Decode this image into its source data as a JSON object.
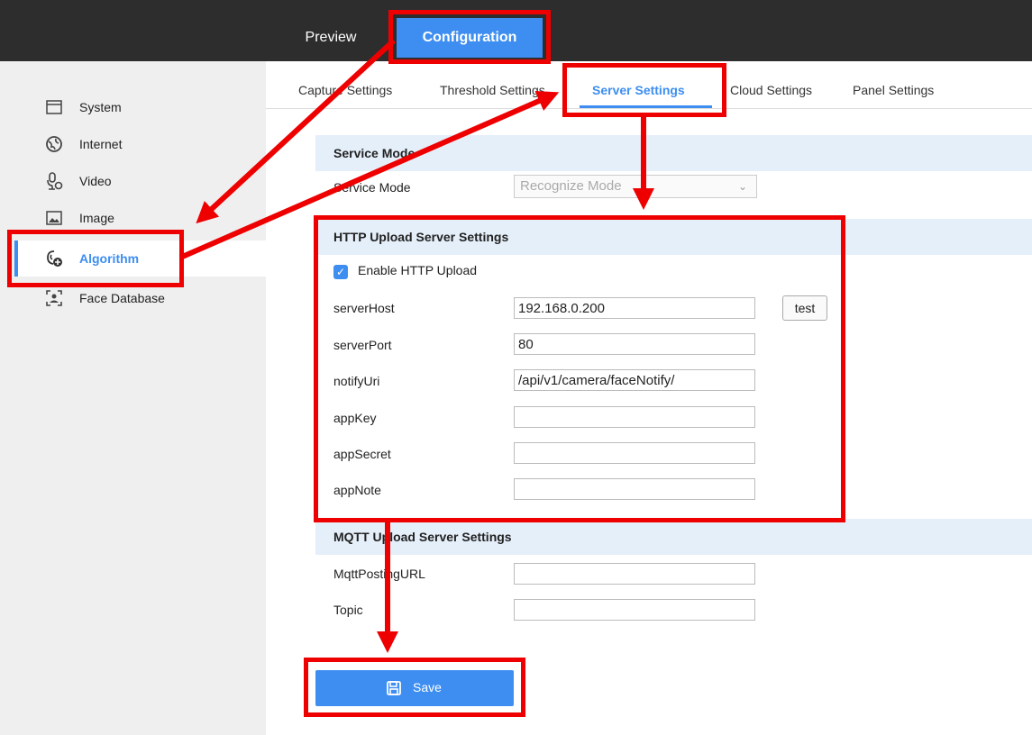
{
  "topbar": {
    "tabs": [
      {
        "label": "Preview"
      },
      {
        "label": "Configuration"
      }
    ]
  },
  "sidebar": {
    "items": [
      {
        "label": "System",
        "icon": "system-icon"
      },
      {
        "label": "Internet",
        "icon": "globe-icon"
      },
      {
        "label": "Video",
        "icon": "microphone-icon"
      },
      {
        "label": "Image",
        "icon": "image-icon"
      },
      {
        "label": "Algorithm",
        "icon": "algorithm-icon",
        "active": true
      },
      {
        "label": "Face Database",
        "icon": "face-icon"
      }
    ]
  },
  "subtabs": [
    {
      "label": "Capture Settings"
    },
    {
      "label": "Threshold Settings"
    },
    {
      "label": "Server Settings",
      "active": true
    },
    {
      "label": "Cloud Settings"
    },
    {
      "label": "Panel Settings"
    }
  ],
  "service_mode": {
    "heading": "Service Mode",
    "label": "Service Mode",
    "value": "Recognize Mode"
  },
  "http": {
    "heading": "HTTP Upload Server Settings",
    "enable_label": "Enable HTTP Upload",
    "enabled": true,
    "test_label": "test",
    "fields": [
      {
        "label": "serverHost",
        "value": "192.168.0.200"
      },
      {
        "label": "serverPort",
        "value": "80"
      },
      {
        "label": "notifyUri",
        "value": "/api/v1/camera/faceNotify/"
      },
      {
        "label": "appKey",
        "value": ""
      },
      {
        "label": "appSecret",
        "value": ""
      },
      {
        "label": "appNote",
        "value": ""
      }
    ]
  },
  "mqtt": {
    "heading": "MQTT Upload Server Settings",
    "fields": [
      {
        "label": "MqttPostingURL",
        "value": ""
      },
      {
        "label": "Topic",
        "value": ""
      }
    ]
  },
  "save_label": "Save",
  "colors": {
    "accent": "#3d8ef0",
    "annotation": "#ee0000",
    "topbar": "#2d2d2d"
  }
}
